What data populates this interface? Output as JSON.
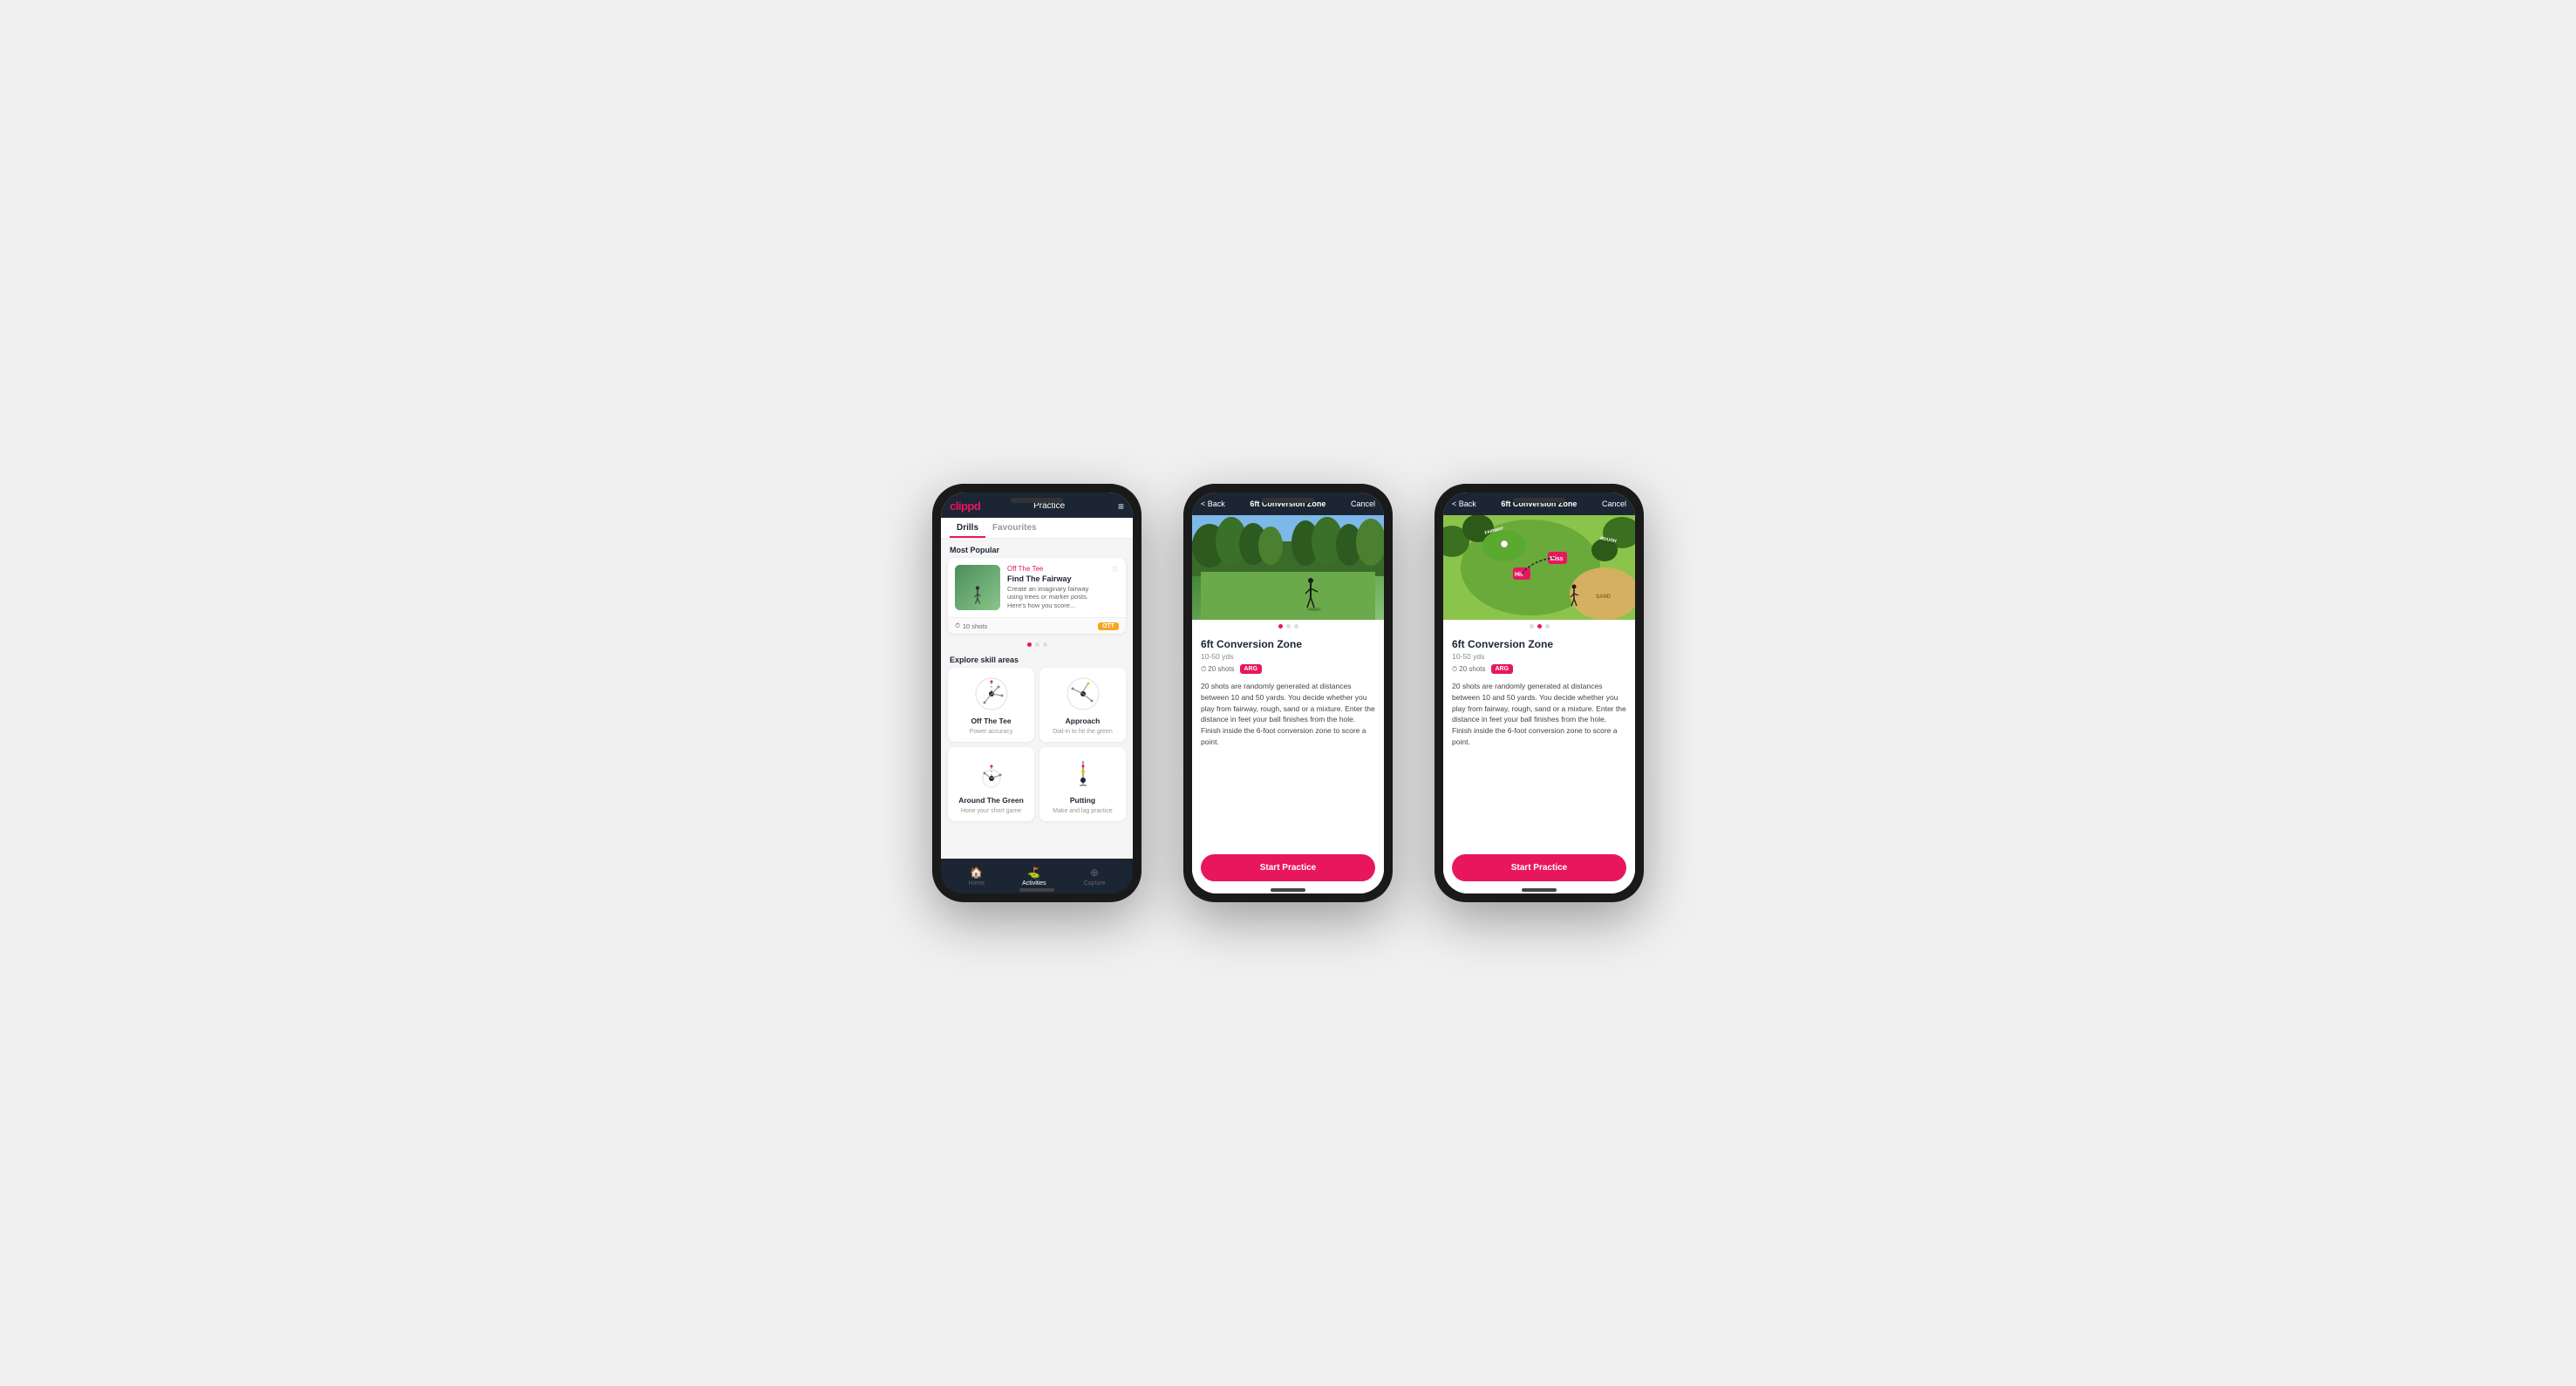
{
  "phone1": {
    "header": {
      "logo": "clippd",
      "title": "Practice",
      "menu_icon": "≡"
    },
    "tabs": [
      {
        "label": "Drills",
        "active": true
      },
      {
        "label": "Favourites",
        "active": false
      }
    ],
    "most_popular_title": "Most Popular",
    "featured_card": {
      "title": "Find The Fairway",
      "subtitle": "Off The Tee",
      "description": "Create an imaginary fairway using trees or marker posts. Here's how you score...",
      "shots": "10 shots",
      "badge": "OTT"
    },
    "explore_title": "Explore skill areas",
    "skill_areas": [
      {
        "name": "Off The Tee",
        "desc": "Power accuracy"
      },
      {
        "name": "Approach",
        "desc": "Dial-in to hit the green"
      },
      {
        "name": "Around The Green",
        "desc": "Hone your short game"
      },
      {
        "name": "Putting",
        "desc": "Make and lag practice"
      }
    ],
    "nav": [
      {
        "icon": "🏠",
        "label": "Home",
        "active": false
      },
      {
        "icon": "⛳",
        "label": "Activities",
        "active": true
      },
      {
        "icon": "⊕",
        "label": "Capture",
        "active": false
      }
    ]
  },
  "phone2": {
    "header": {
      "back_label": "< Back",
      "title": "6ft Conversion Zone",
      "cancel_label": "Cancel"
    },
    "drill_title": "6ft Conversion Zone",
    "drill_range": "10-50 yds",
    "shots": "20 shots",
    "badge": "ARG",
    "description": "20 shots are randomly generated at distances between 10 and 50 yards. You decide whether you play from fairway, rough, sand or a mixture. Enter the distance in feet your ball finishes from the hole. Finish inside the 6-foot conversion zone to score a point.",
    "start_button": "Start Practice",
    "image_type": "photo",
    "dots": [
      true,
      false,
      false
    ]
  },
  "phone3": {
    "header": {
      "back_label": "< Back",
      "title": "6ft Conversion Zone",
      "cancel_label": "Cancel"
    },
    "drill_title": "6ft Conversion Zone",
    "drill_range": "10-50 yds",
    "shots": "20 shots",
    "badge": "ARG",
    "description": "20 shots are randomly generated at distances between 10 and 50 yards. You decide whether you play from fairway, rough, sand or a mixture. Enter the distance in feet your ball finishes from the hole. Finish inside the 6-foot conversion zone to score a point.",
    "start_button": "Start Practice",
    "image_type": "map",
    "dots": [
      false,
      true,
      false
    ]
  }
}
